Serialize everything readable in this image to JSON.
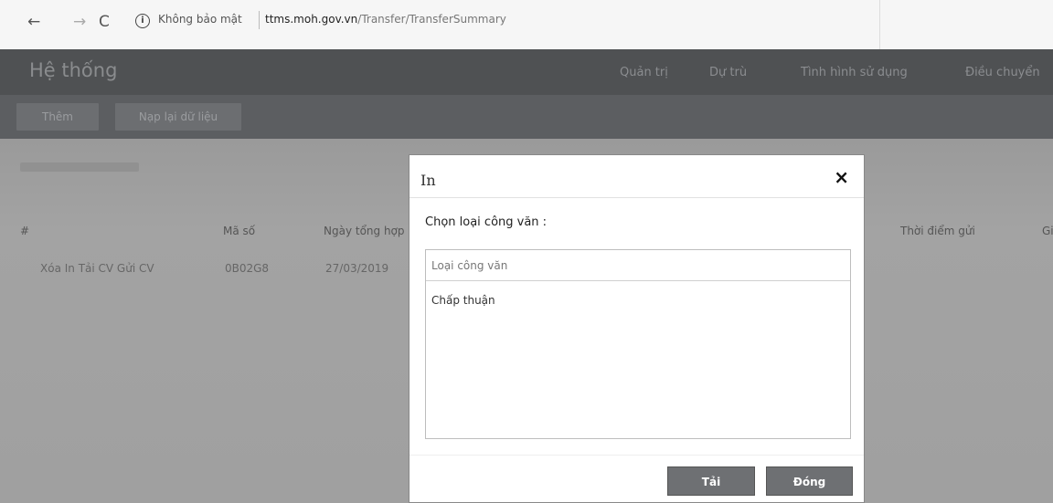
{
  "browser": {
    "back": "←",
    "forward": "→",
    "reload": "C",
    "info": "i",
    "security_label": "Không bảo mật",
    "url_domain": "ttms.moh.gov.vn",
    "url_path": "/Transfer/TransferSummary"
  },
  "header": {
    "brand": "Hệ thống",
    "menu": [
      "Quản trị",
      "Dự trù",
      "Tình hình sử dụng",
      "Điều chuyển"
    ]
  },
  "toolbar": {
    "add_label": "Thêm",
    "reload_label": "Nạp lại dữ liệu"
  },
  "table": {
    "headers": [
      "#",
      "Mã số",
      "Ngày tổng hợp",
      "Thời điểm gửi",
      "Gi"
    ],
    "rows": [
      {
        "actions": "Xóa In Tải CV Gửi CV",
        "code": "0B02G8",
        "date": "27/03/2019"
      }
    ]
  },
  "modal": {
    "title": "In",
    "close": "×",
    "label": "Chọn loại công văn :",
    "list_header": "Loại công văn",
    "items": [
      "Chấp thuận"
    ],
    "download_label": "Tải",
    "close_label": "Đóng"
  }
}
